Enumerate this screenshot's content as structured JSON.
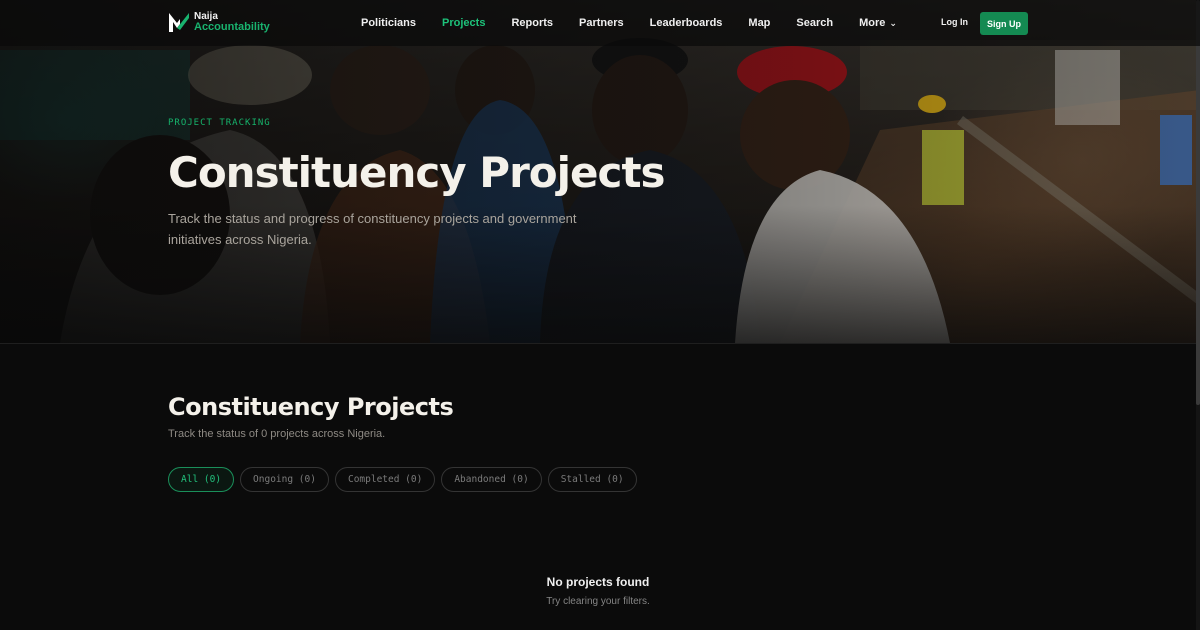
{
  "brand": {
    "line1": "Naija",
    "line2": "Accountability"
  },
  "nav": {
    "items": [
      {
        "label": "Politicians",
        "active": false
      },
      {
        "label": "Projects",
        "active": true
      },
      {
        "label": "Reports",
        "active": false
      },
      {
        "label": "Partners",
        "active": false
      },
      {
        "label": "Leaderboards",
        "active": false
      },
      {
        "label": "Map",
        "active": false
      },
      {
        "label": "Search",
        "active": false
      }
    ],
    "more_label": "More",
    "login_label": "Log In",
    "signup_label": "Sign Up"
  },
  "hero": {
    "eyebrow": "PROJECT TRACKING",
    "title": "Constituency Projects",
    "subtitle": "Track the status and progress of constituency projects and government initiatives across Nigeria."
  },
  "section": {
    "title": "Constituency Projects",
    "subtitle": "Track the status of 0 projects across Nigeria."
  },
  "filters": [
    {
      "label": "All (0)",
      "active": true
    },
    {
      "label": "Ongoing (0)",
      "active": false
    },
    {
      "label": "Completed (0)",
      "active": false
    },
    {
      "label": "Abandoned (0)",
      "active": false
    },
    {
      "label": "Stalled (0)",
      "active": false
    }
  ],
  "empty_state": {
    "title": "No projects found",
    "subtitle": "Try clearing your filters."
  },
  "colors": {
    "accent": "#148a52",
    "accent_text": "#1dc27a",
    "background": "#0b0b0b"
  }
}
